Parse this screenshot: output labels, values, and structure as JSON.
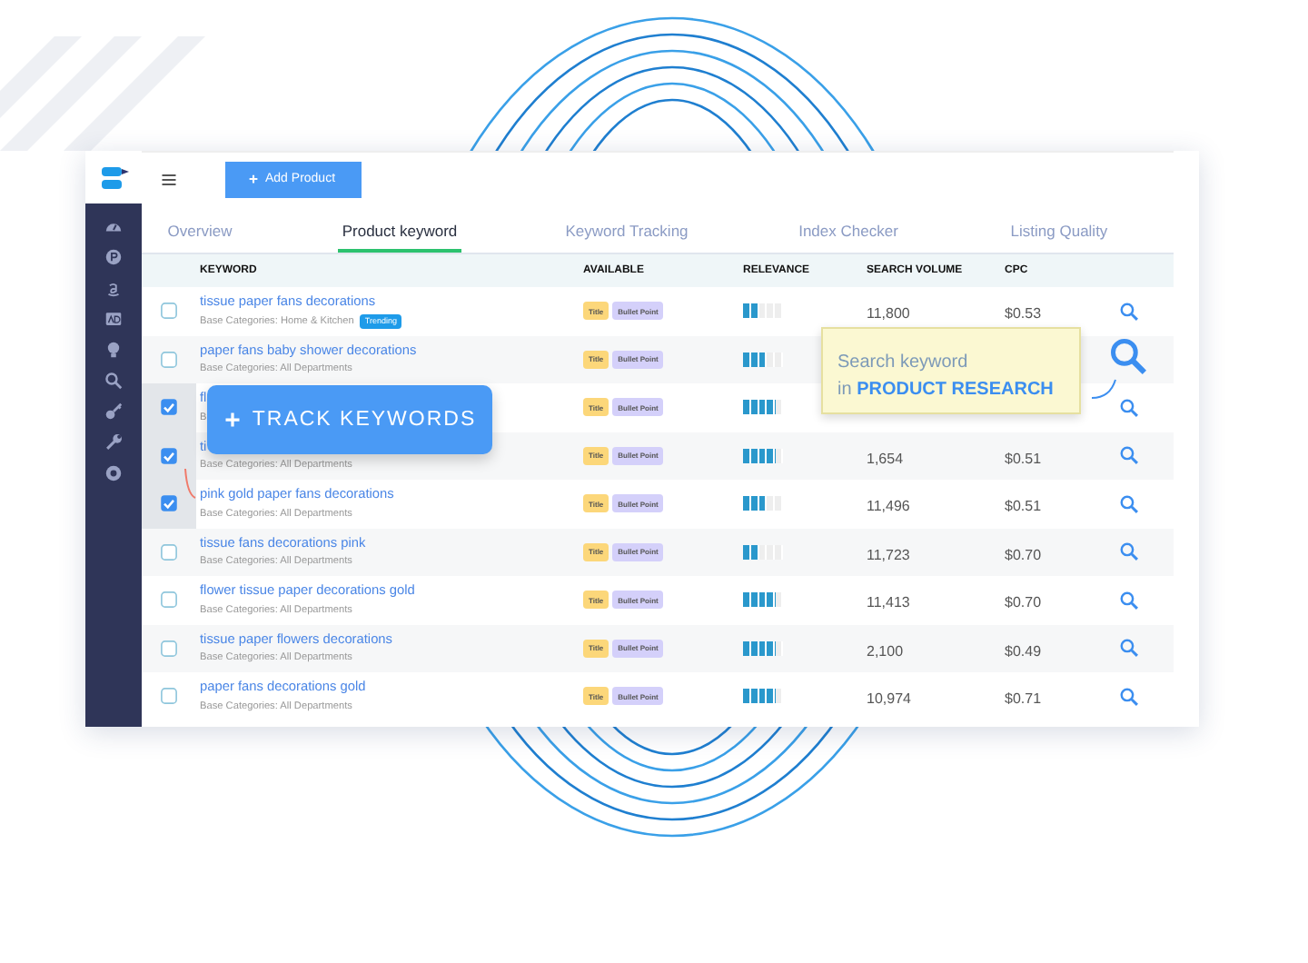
{
  "toolbar": {
    "add_button": "Add Product"
  },
  "tabs": [
    {
      "label": "Overview",
      "selected": false
    },
    {
      "label": "Product keyword",
      "selected": true
    },
    {
      "label": "Keyword Tracking",
      "selected": false
    },
    {
      "label": "Index Checker",
      "selected": false
    },
    {
      "label": "Listing Quality",
      "selected": false
    }
  ],
  "table": {
    "columns": [
      "KEYWORD",
      "AVAILABLE",
      "RELEVANCE",
      "SEARCH VOLUME",
      "CPC"
    ],
    "rows": [
      {
        "checked": false,
        "keyword": "tissue paper fans decorations",
        "category": "Base Categories: Home & Kitchen",
        "badge": "Trending",
        "tags": [
          "Title",
          "Bullet Point"
        ],
        "level": 0.4,
        "search_volume": "11,800",
        "cpc": "$0.53",
        "icon_large": false
      },
      {
        "checked": false,
        "keyword": "paper fans baby shower decorations",
        "category": "Base Categories: All Departments",
        "tags": [
          "Title",
          "Bullet Point"
        ],
        "level": 0.6,
        "icon_large": true
      },
      {
        "checked": true,
        "keyword": "fl",
        "category": "B",
        "tags": [
          "Title",
          "Bullet Point"
        ],
        "level": 0.8,
        "icon_large": false
      },
      {
        "checked": true,
        "keyword": "ti",
        "category": "Base Categories: All Departments",
        "tags": [
          "Title",
          "Bullet Point"
        ],
        "level": 0.8,
        "search_volume": "1,654",
        "cpc": "$0.51",
        "icon_large": false
      },
      {
        "checked": true,
        "keyword": "pink gold paper fans decorations",
        "category": "Base Categories: All Departments",
        "tags": [
          "Title",
          "Bullet Point"
        ],
        "level": 0.6,
        "search_volume": "11,496",
        "cpc": "$0.51",
        "icon_large": false
      },
      {
        "checked": false,
        "keyword": "tissue fans decorations pink",
        "category": "Base Categories: All Departments",
        "tags": [
          "Title",
          "Bullet Point"
        ],
        "level": 0.4,
        "search_volume": "11,723",
        "cpc": "$0.70",
        "icon_large": false
      },
      {
        "checked": false,
        "keyword": "flower tissue paper decorations gold",
        "category": "Base Categories: All Departments",
        "tags": [
          "Title",
          "Bullet Point"
        ],
        "level": 0.8,
        "search_volume": "11,413",
        "cpc": "$0.70",
        "icon_large": false
      },
      {
        "checked": false,
        "keyword": "tissue paper flowers decorations",
        "category": "Base Categories: All Departments",
        "tags": [
          "Title",
          "Bullet Point"
        ],
        "level": 0.8,
        "search_volume": "2,100",
        "cpc": "$0.49",
        "icon_large": false
      },
      {
        "checked": false,
        "keyword": "paper fans decorations gold",
        "category": "Base Categories: All Departments",
        "tags": [
          "Title",
          "Bullet Point"
        ],
        "level": 0.8,
        "search_volume": "10,974",
        "cpc": "$0.71",
        "icon_large": false
      }
    ]
  },
  "track_button": "TRACK KEYWORDS",
  "tooltip": "Search keyword in **PRODUCT RESEARCH**"
}
